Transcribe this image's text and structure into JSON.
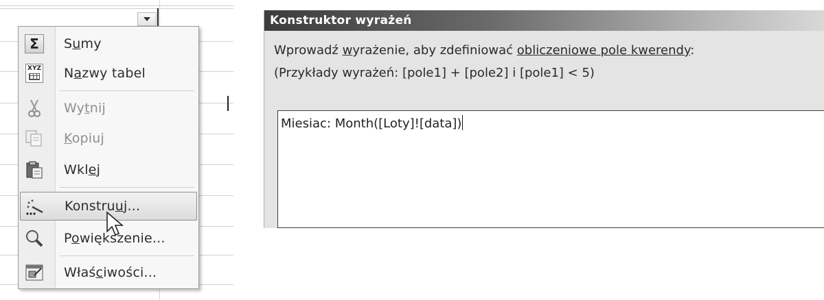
{
  "context_menu": {
    "items": [
      {
        "label_pre": "S",
        "label_key": "u",
        "label_post": "my",
        "icon": "sigma-icon",
        "glyph": "Σ",
        "enabled": true
      },
      {
        "label_pre": "N",
        "label_key": "a",
        "label_post": "zwy tabel",
        "icon": "table-names-icon",
        "glyph": "XYZ",
        "enabled": true
      },
      {
        "label_pre": "Wy",
        "label_key": "t",
        "label_post": "nij",
        "icon": "scissors-icon",
        "enabled": false
      },
      {
        "label_pre": "",
        "label_key": "K",
        "label_post": "opiuj",
        "icon": "copy-icon",
        "enabled": false
      },
      {
        "label_pre": "Wkl",
        "label_key": "e",
        "label_post": "j",
        "icon": "clipboard-icon",
        "enabled": true
      },
      {
        "label_pre": "Konstru",
        "label_key": "u",
        "label_post": "j...",
        "icon": "builder-wand-icon",
        "enabled": true,
        "highlighted": true
      },
      {
        "label_pre": "P",
        "label_key": "o",
        "label_post": "większenie...",
        "icon": "magnifier-icon",
        "enabled": true
      },
      {
        "label_pre": "Właś",
        "label_key": "c",
        "label_post": "iwości...",
        "icon": "properties-icon",
        "enabled": true
      }
    ]
  },
  "expression_builder": {
    "title": "Konstruktor wyrażeń",
    "instruction_pre": "Wprowadź ",
    "instruction_key": "w",
    "instruction_mid": "yrażenie, aby zdefiniować ",
    "instruction_link": "obliczeniowe pole kwerendy",
    "instruction_post": ":",
    "examples": "(Przykłady wyrażeń: [pole1] + [pole2] i [pole1] < 5)",
    "expression_value": "Miesiac: Month([Loty]![data])"
  },
  "colors": {
    "title_bar_dark": "#3c3c3c",
    "menu_highlight": "#dcdcdc",
    "dialog_background": "#e4e4e4"
  }
}
